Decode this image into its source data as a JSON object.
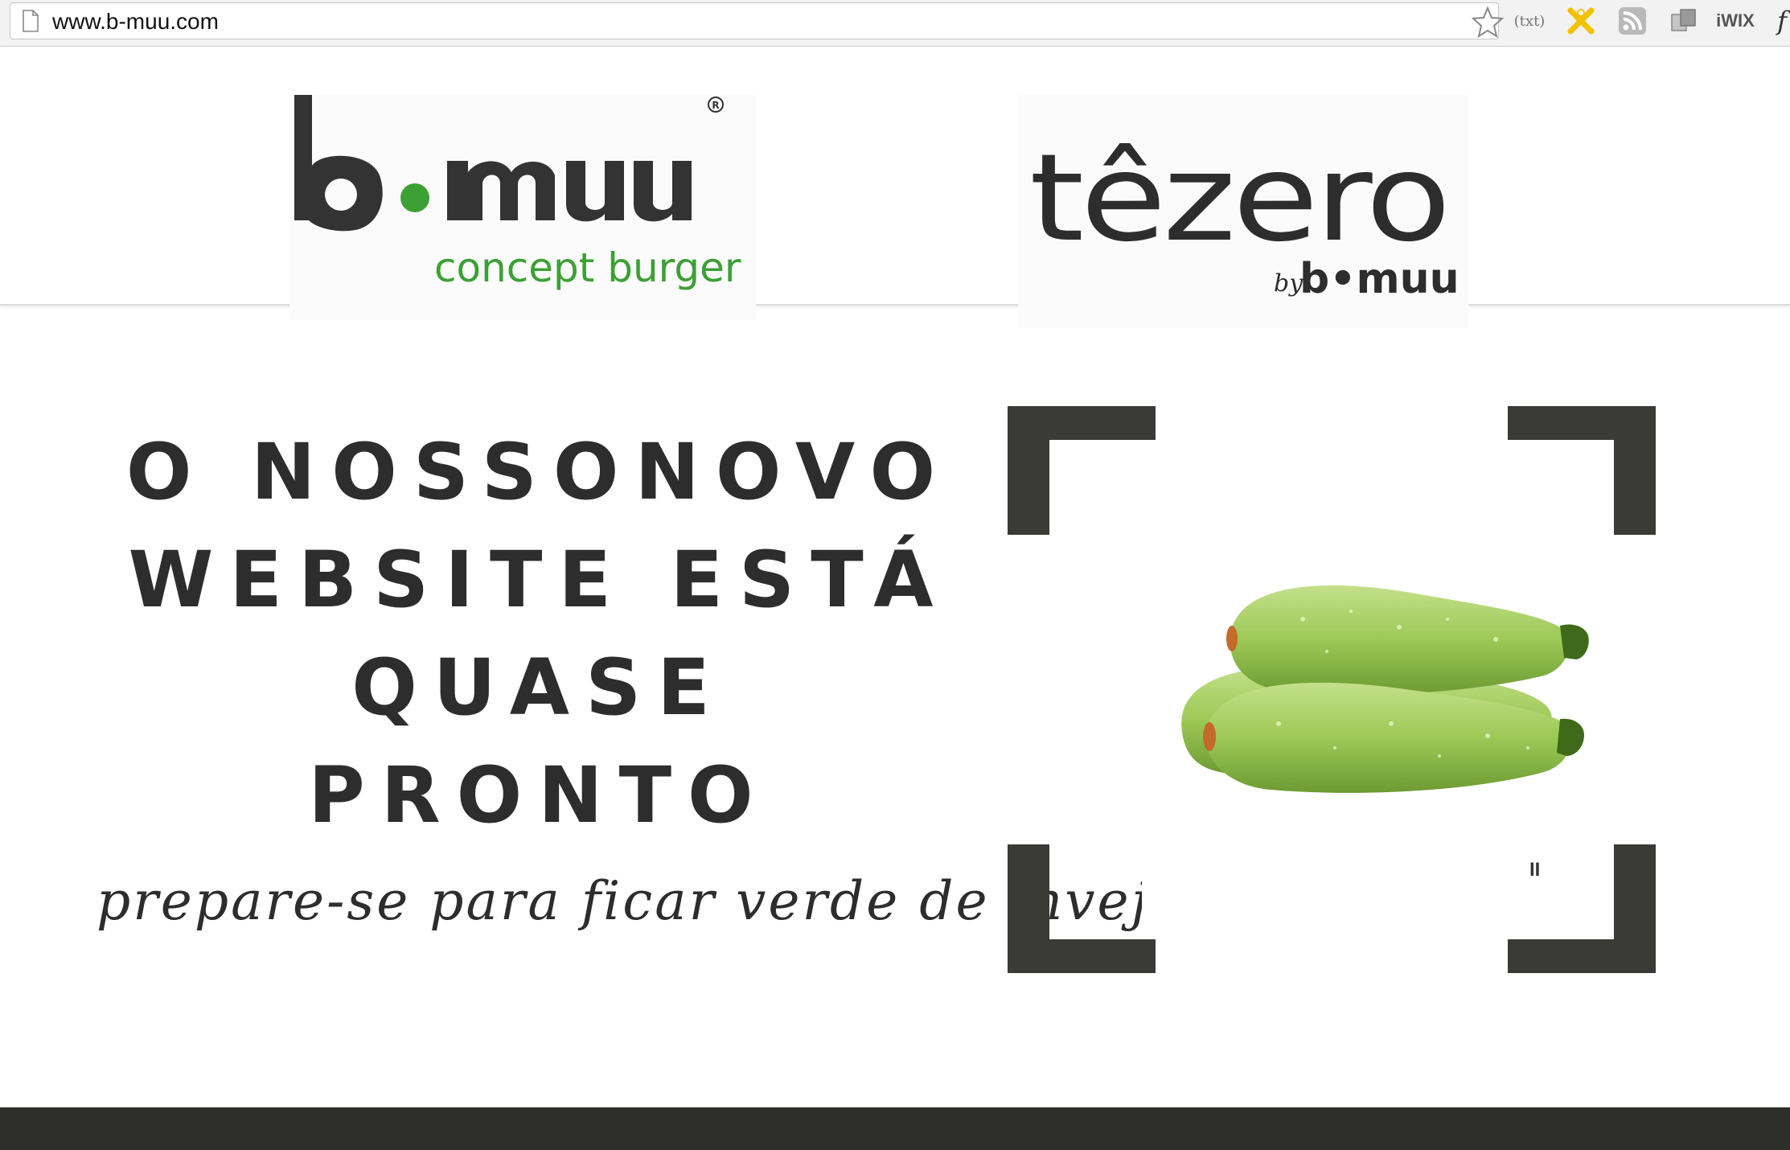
{
  "browser": {
    "url": "www.b-muu.com",
    "extensions": [
      {
        "name": "bullet-extension-icon",
        "label": "(txt)"
      },
      {
        "name": "x-extension-icon",
        "label": ""
      },
      {
        "name": "rss-icon",
        "label": ""
      },
      {
        "name": "copy-extension-icon",
        "label": ""
      },
      {
        "name": "wix-extension-icon",
        "label": "iWIX"
      },
      {
        "name": "f-extension-icon",
        "label": "f"
      }
    ]
  },
  "header": {
    "logo_left": {
      "brand": "b•muu",
      "subtitle": "concept burger",
      "mark": "R"
    },
    "logo_right": {
      "brand": "têzero",
      "byline_by": "by",
      "byline_brand": "b•muu"
    }
  },
  "hero": {
    "headline_lines": [
      "O NOSSONOVO",
      "WEBSITE ESTÁ",
      "QUASE",
      "PRONTO"
    ],
    "tagline": "prepare-se para ficar verde de inveja",
    "pause_mark": "II"
  },
  "colors": {
    "text_dark": "#2d2d2d",
    "frame": "#3a3a36",
    "brand_green": "#3da035",
    "footer_bg": "#2d2d2b",
    "zucchini": "#9cc956"
  }
}
